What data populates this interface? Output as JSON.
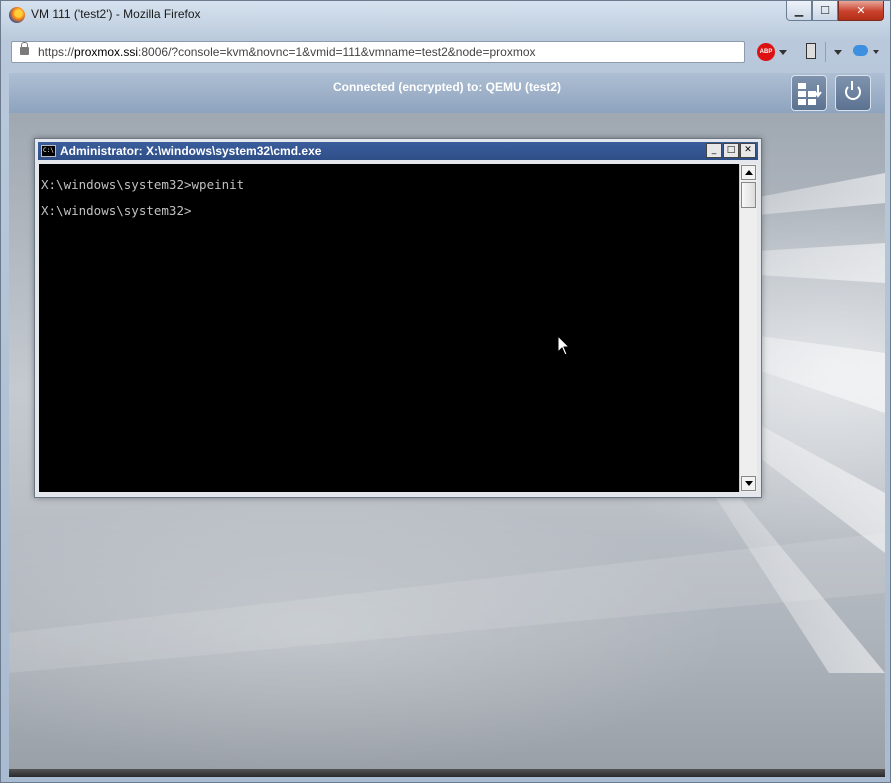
{
  "window": {
    "title": "VM 111 ('test2') - Mozilla Firefox",
    "icon": "firefox-icon",
    "controls": {
      "minimize": "▁",
      "maximize": "☐",
      "close": "✕"
    }
  },
  "toolbar": {
    "url_prefix": "https://",
    "url_host": "proxmox.ssi",
    "url_rest": ":8006/?console=kvm&novnc=1&vmid=111&vmname=test2&node=proxmox",
    "abp_label": "ABP"
  },
  "console": {
    "status": "Connected (encrypted) to: QEMU (test2)",
    "buttons": {
      "send_keys": "send-keys-icon",
      "power": "power-icon"
    }
  },
  "cmd_window": {
    "title": "Administrator: X:\\windows\\system32\\cmd.exe",
    "icon_text": "C:\\",
    "controls": {
      "minimize": "_",
      "maximize": "□",
      "close": "✕"
    },
    "lines": [
      "X:\\windows\\system32>wpeinit",
      "X:\\windows\\system32>"
    ]
  },
  "colors": {
    "titlebar_blue": "#2e4e87",
    "close_red": "#c8402b",
    "abp_red": "#dd1111"
  }
}
